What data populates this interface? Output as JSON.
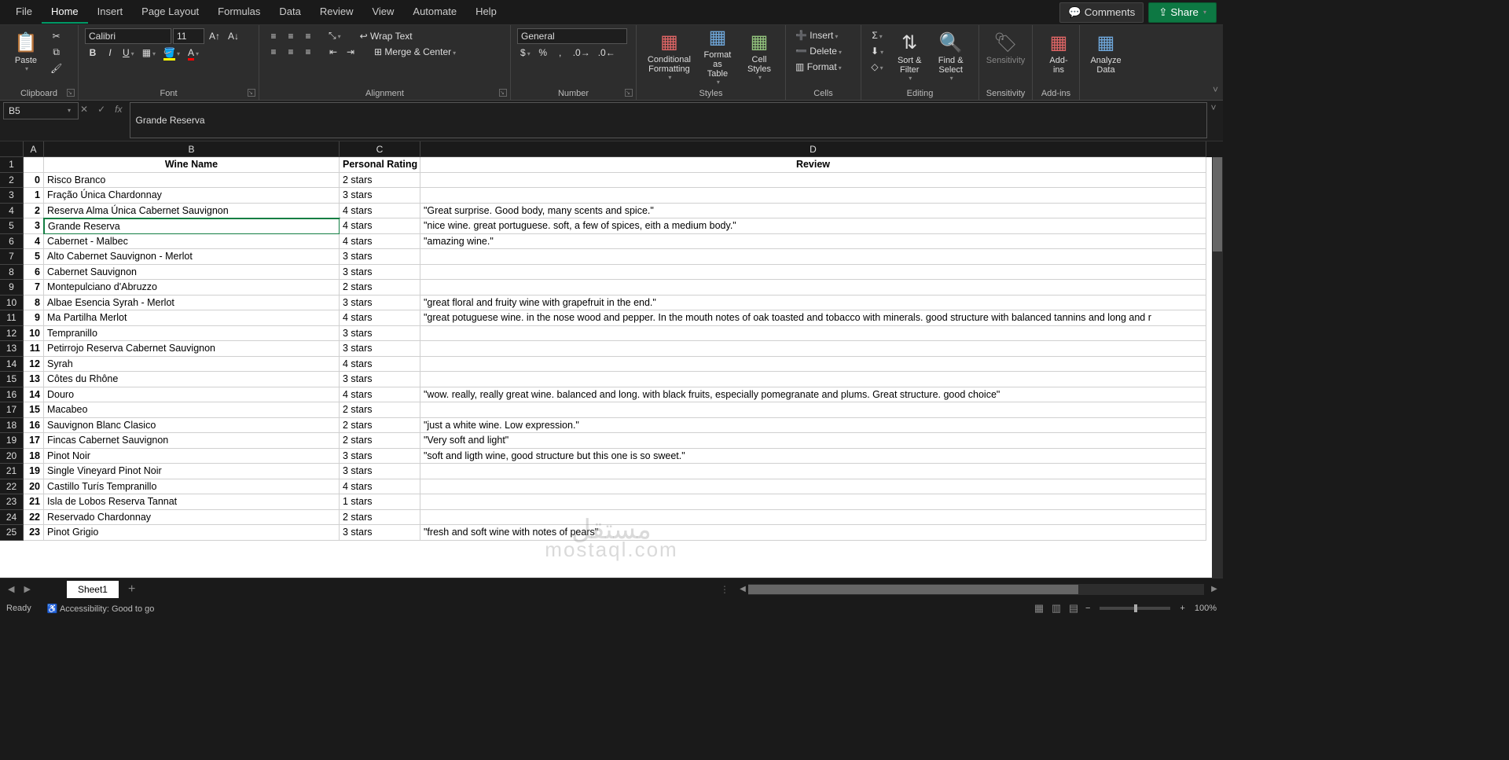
{
  "menu": {
    "tabs": [
      "File",
      "Home",
      "Insert",
      "Page Layout",
      "Formulas",
      "Data",
      "Review",
      "View",
      "Automate",
      "Help"
    ],
    "active": "Home",
    "comments": "Comments",
    "share": "Share"
  },
  "ribbon": {
    "clipboard": {
      "label": "Clipboard",
      "paste": "Paste"
    },
    "font": {
      "label": "Font",
      "name": "Calibri",
      "size": "11"
    },
    "alignment": {
      "label": "Alignment",
      "wrap": "Wrap Text",
      "merge": "Merge & Center"
    },
    "number": {
      "label": "Number",
      "format": "General"
    },
    "styles": {
      "label": "Styles",
      "cond": "Conditional Formatting",
      "table": "Format as Table",
      "cell": "Cell Styles"
    },
    "cells": {
      "label": "Cells",
      "insert": "Insert",
      "delete": "Delete",
      "format": "Format"
    },
    "editing": {
      "label": "Editing",
      "sort": "Sort & Filter",
      "find": "Find & Select"
    },
    "sensitivity": {
      "label": "Sensitivity",
      "btn": "Sensitivity"
    },
    "addins": {
      "label": "Add-ins",
      "btn": "Add-ins"
    },
    "analyze": {
      "label": "",
      "btn": "Analyze Data"
    }
  },
  "namebox": {
    "ref": "B5",
    "formula": "Grande Reserva"
  },
  "grid": {
    "columns": [
      "A",
      "B",
      "C",
      "D"
    ],
    "headerRow": {
      "A": "",
      "B": "Wine Name",
      "C": "Personal Rating",
      "D": "Review"
    },
    "rows": [
      {
        "n": "2",
        "A": "0",
        "B": "Risco Branco",
        "C": "2 stars",
        "D": ""
      },
      {
        "n": "3",
        "A": "1",
        "B": "Fração Única Chardonnay",
        "C": "3 stars",
        "D": ""
      },
      {
        "n": "4",
        "A": "2",
        "B": "Reserva Alma Única Cabernet Sauvignon",
        "C": "4 stars",
        "D": "\"Great surprise. Good body, many scents and spice.\""
      },
      {
        "n": "5",
        "A": "3",
        "B": "Grande Reserva",
        "C": "4 stars",
        "D": "\"nice wine. great portuguese. soft, a few of spices, eith a medium body.\""
      },
      {
        "n": "6",
        "A": "4",
        "B": "Cabernet - Malbec",
        "C": "4 stars",
        "D": "\"amazing wine.\""
      },
      {
        "n": "7",
        "A": "5",
        "B": "Alto Cabernet Sauvignon - Merlot",
        "C": "3 stars",
        "D": ""
      },
      {
        "n": "8",
        "A": "6",
        "B": "Cabernet Sauvignon",
        "C": "3 stars",
        "D": ""
      },
      {
        "n": "9",
        "A": "7",
        "B": "Montepulciano d'Abruzzo",
        "C": "2 stars",
        "D": ""
      },
      {
        "n": "10",
        "A": "8",
        "B": "Albae Esencia Syrah - Merlot",
        "C": "3 stars",
        "D": "\"great floral and fruity wine with grapefruit in the end.\""
      },
      {
        "n": "11",
        "A": "9",
        "B": "Ma Partilha Merlot",
        "C": "4 stars",
        "D": "\"great potuguese wine. in the nose wood and pepper. In the mouth notes of oak toasted and tobacco with minerals. good structure with balanced tannins and long and r"
      },
      {
        "n": "12",
        "A": "10",
        "B": "Tempranillo",
        "C": "3 stars",
        "D": ""
      },
      {
        "n": "13",
        "A": "11",
        "B": "Petirrojo Reserva Cabernet Sauvignon",
        "C": "3 stars",
        "D": ""
      },
      {
        "n": "14",
        "A": "12",
        "B": "Syrah",
        "C": "4 stars",
        "D": ""
      },
      {
        "n": "15",
        "A": "13",
        "B": "Côtes du Rhône",
        "C": "3 stars",
        "D": ""
      },
      {
        "n": "16",
        "A": "14",
        "B": "Douro",
        "C": "4 stars",
        "D": "\"wow. really, really great wine. balanced and long. with black fruits, especially pomegranate and plums. Great structure. good choice\""
      },
      {
        "n": "17",
        "A": "15",
        "B": "Macabeo",
        "C": "2 stars",
        "D": ""
      },
      {
        "n": "18",
        "A": "16",
        "B": "Sauvignon Blanc Clasico",
        "C": "2 stars",
        "D": "\"just a white wine. Low expression.\""
      },
      {
        "n": "19",
        "A": "17",
        "B": "Fincas Cabernet Sauvignon",
        "C": "2 stars",
        "D": "\"Very soft and light\""
      },
      {
        "n": "20",
        "A": "18",
        "B": "Pinot Noir",
        "C": "3 stars",
        "D": "\"soft and ligth wine, good structure but this one is so sweet.\""
      },
      {
        "n": "21",
        "A": "19",
        "B": "Single Vineyard Pinot Noir",
        "C": "3 stars",
        "D": ""
      },
      {
        "n": "22",
        "A": "20",
        "B": "Castillo Turís Tempranillo",
        "C": "4 stars",
        "D": ""
      },
      {
        "n": "23",
        "A": "21",
        "B": "Isla de Lobos Reserva Tannat",
        "C": "1 stars",
        "D": ""
      },
      {
        "n": "24",
        "A": "22",
        "B": "Reservado Chardonnay",
        "C": "2 stars",
        "D": ""
      },
      {
        "n": "25",
        "A": "23",
        "B": "Pinot Grigio",
        "C": "3 stars",
        "D": "\"fresh and soft wine with notes of pears\""
      }
    ],
    "selected": "B5"
  },
  "sheet": {
    "name": "Sheet1"
  },
  "status": {
    "ready": "Ready",
    "access": "Accessibility: Good to go",
    "zoom": "100%"
  },
  "watermark": {
    "ar": "مستقل",
    "en": "mostaql.com"
  }
}
